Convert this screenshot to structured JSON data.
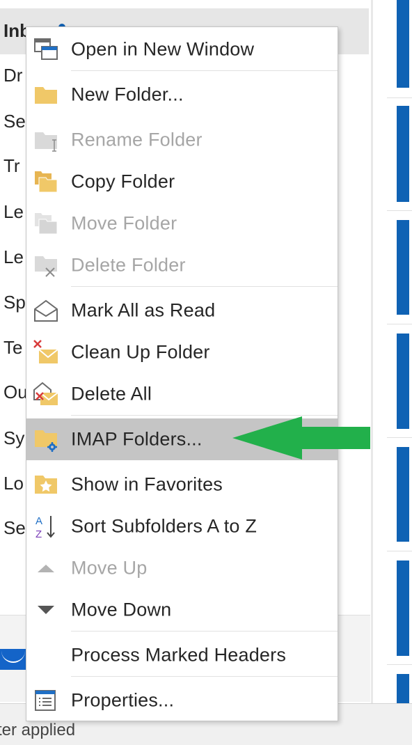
{
  "folders": {
    "selected_label": "Inb",
    "items": [
      "Dr",
      "Se",
      "Tr",
      "Le",
      "Le",
      "Sp",
      "Te",
      "Ou",
      "Sy",
      "Lo",
      "Se"
    ]
  },
  "status_bar": {
    "text": "ter applied"
  },
  "context_menu": {
    "items": [
      {
        "label": "Open in New Window",
        "icon": "open-window-icon",
        "disabled": false
      },
      {
        "label": "New Folder...",
        "icon": "new-folder-icon",
        "disabled": false
      },
      {
        "label": "Rename Folder",
        "icon": "rename-folder-icon",
        "disabled": true
      },
      {
        "label": "Copy Folder",
        "icon": "copy-folder-icon",
        "disabled": false
      },
      {
        "label": "Move Folder",
        "icon": "move-folder-icon",
        "disabled": true
      },
      {
        "label": "Delete Folder",
        "icon": "delete-folder-icon",
        "disabled": true
      },
      {
        "label": "Mark All as Read",
        "icon": "mark-read-icon",
        "disabled": false
      },
      {
        "label": "Clean Up Folder",
        "icon": "clean-up-icon",
        "disabled": false
      },
      {
        "label": "Delete All",
        "icon": "delete-all-icon",
        "disabled": false
      },
      {
        "label": "IMAP Folders...",
        "icon": "imap-folders-icon",
        "disabled": false,
        "highlighted": true
      },
      {
        "label": "Show in Favorites",
        "icon": "favorites-star-icon",
        "disabled": false
      },
      {
        "label": "Sort Subfolders A to Z",
        "icon": "sort-az-icon",
        "disabled": false
      },
      {
        "label": "Move Up",
        "icon": "triangle-up-icon",
        "disabled": true
      },
      {
        "label": "Move Down",
        "icon": "triangle-down-icon",
        "disabled": false
      },
      {
        "label": "Process Marked Headers",
        "icon": "",
        "disabled": false
      },
      {
        "label": "Properties...",
        "icon": "properties-icon",
        "disabled": false
      }
    ]
  },
  "annotation": {
    "arrow_color": "#22b04b",
    "points_to": "IMAP Folders..."
  },
  "colors": {
    "accent": "#0f62b4",
    "menu_highlight": "#c5c5c5",
    "disabled_text": "#a6a6a6",
    "folder_yellow": "#f0c868"
  }
}
